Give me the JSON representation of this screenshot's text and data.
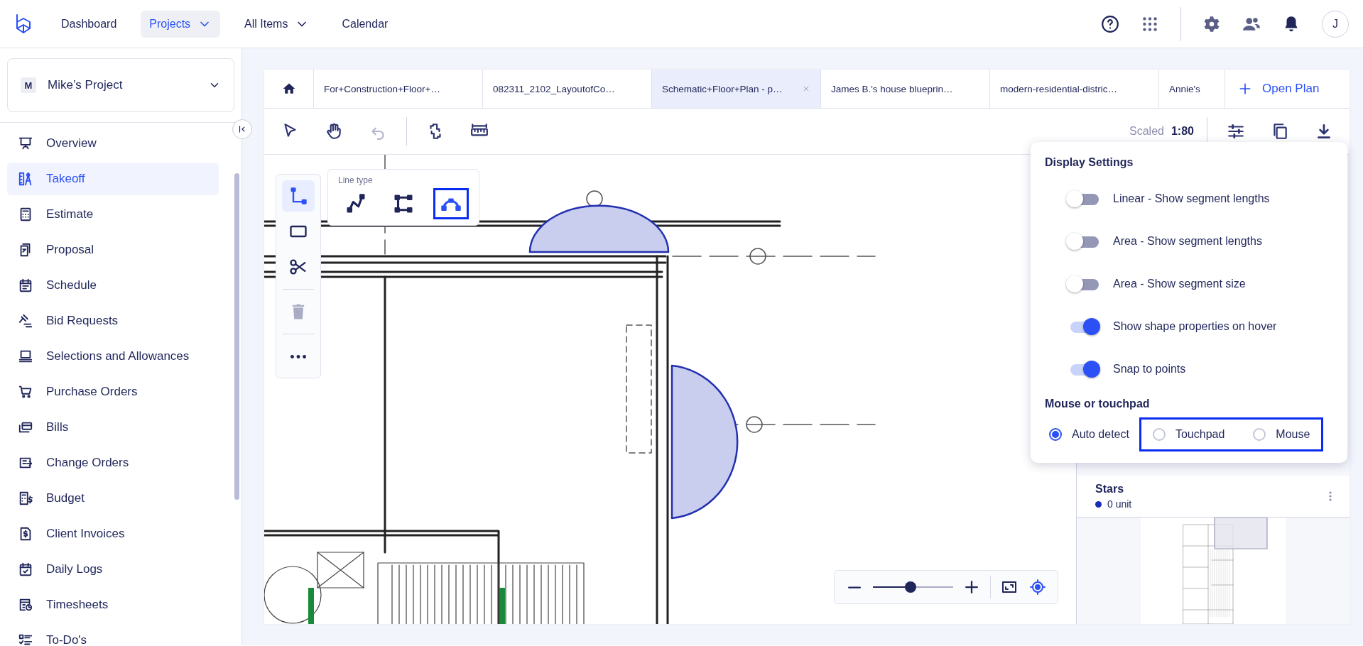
{
  "topbar": {
    "nav": [
      {
        "label": "Dashboard",
        "selected": false,
        "dropdown": false
      },
      {
        "label": "Projects",
        "selected": true,
        "dropdown": true
      },
      {
        "label": "All Items",
        "selected": false,
        "dropdown": true
      },
      {
        "label": "Calendar",
        "selected": false,
        "dropdown": false
      }
    ],
    "avatar": "J"
  },
  "sidebar": {
    "project": {
      "initial": "M",
      "name": "Mike’s Project"
    },
    "items": [
      {
        "label": "Overview",
        "selected": false
      },
      {
        "label": "Takeoff",
        "selected": true
      },
      {
        "label": "Estimate",
        "selected": false
      },
      {
        "label": "Proposal",
        "selected": false
      },
      {
        "label": "Schedule",
        "selected": false
      },
      {
        "label": "Bid Requests",
        "selected": false
      },
      {
        "label": "Selections and Allowances",
        "selected": false
      },
      {
        "label": "Purchase Orders",
        "selected": false
      },
      {
        "label": "Bills",
        "selected": false
      },
      {
        "label": "Change Orders",
        "selected": false
      },
      {
        "label": "Budget",
        "selected": false
      },
      {
        "label": "Client Invoices",
        "selected": false
      },
      {
        "label": "Daily Logs",
        "selected": false
      },
      {
        "label": "Timesheets",
        "selected": false
      },
      {
        "label": "To-Do's",
        "selected": false
      }
    ]
  },
  "tabs": [
    {
      "label": "For+Construction+Floor+…",
      "selected": false
    },
    {
      "label": "082311_2102_LayoutofCo…",
      "selected": false
    },
    {
      "label": "Schematic+Floor+Plan - p…",
      "selected": true
    },
    {
      "label": "James B.'s house blueprin…",
      "selected": false
    },
    {
      "label": "modern-residential-distric…",
      "selected": false
    },
    {
      "label": "Annie's",
      "selected": false
    }
  ],
  "open_plan_button": "Open Plan",
  "toolbar": {
    "tools": [
      {
        "kind": "select",
        "disabled": false
      },
      {
        "kind": "pan",
        "disabled": false
      },
      {
        "kind": "undo",
        "disabled": true
      },
      {
        "kind": "rotate",
        "disabled": false
      },
      {
        "kind": "measure",
        "disabled": false
      }
    ],
    "scale_label": "Scaled",
    "scale_value": "1:80"
  },
  "tool_panel": [
    {
      "kind": "line",
      "selected": true,
      "disabled": false
    },
    {
      "kind": "rectangle",
      "selected": false,
      "disabled": false
    },
    {
      "kind": "scissors",
      "selected": false,
      "disabled": false
    },
    {
      "kind": "divider"
    },
    {
      "kind": "trash",
      "selected": false,
      "disabled": true
    },
    {
      "kind": "divider"
    },
    {
      "kind": "more",
      "selected": false,
      "disabled": false
    }
  ],
  "line_type": {
    "title": "Line type",
    "options": [
      {
        "kind": "polyline",
        "selected": false
      },
      {
        "kind": "orthogonal",
        "selected": false
      },
      {
        "kind": "arc",
        "selected": true
      }
    ]
  },
  "display_settings": {
    "title": "Display Settings",
    "toggles": [
      {
        "label": "Linear - Show segment lengths",
        "on": false
      },
      {
        "label": "Area - Show segment lengths",
        "on": false
      },
      {
        "label": "Area - Show segment size",
        "on": false
      },
      {
        "label": "Show shape properties on hover",
        "on": true
      },
      {
        "label": "Snap to points",
        "on": true
      }
    ],
    "section": "Mouse or touchpad",
    "options": [
      {
        "label": "Auto detect",
        "selected": true,
        "highlighted": false
      },
      {
        "label": "Touchpad",
        "selected": false,
        "highlighted": true
      },
      {
        "label": "Mouse",
        "selected": false,
        "highlighted": true
      }
    ]
  },
  "layers": [
    {
      "name": "Stars",
      "quantity": "0 unit",
      "color": "#1b2bb8"
    }
  ],
  "zoom": {
    "level": 0.47
  }
}
